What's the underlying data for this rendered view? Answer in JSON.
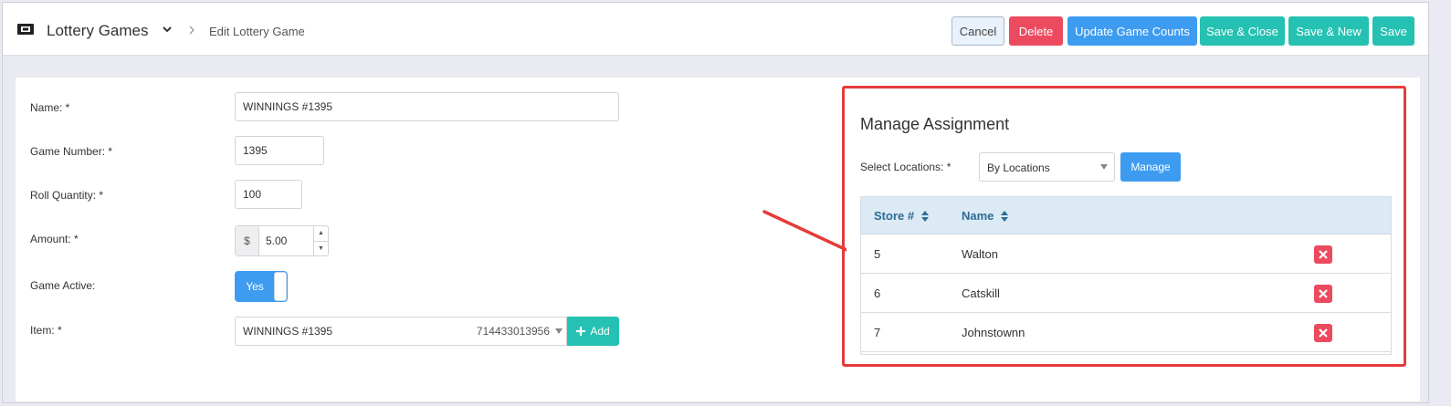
{
  "header": {
    "app_title": "Lottery Games",
    "breadcrumb": "Edit Lottery Game",
    "buttons": {
      "cancel": "Cancel",
      "delete": "Delete",
      "update_counts": "Update Game Counts",
      "save_close": "Save & Close",
      "save_new": "Save & New",
      "save": "Save"
    }
  },
  "form": {
    "name_label": "Name: *",
    "name_value": "WINNINGS #1395",
    "game_number_label": "Game Number: *",
    "game_number_value": "1395",
    "roll_quantity_label": "Roll Quantity: *",
    "roll_quantity_value": "100",
    "amount_label": "Amount: *",
    "amount_prefix": "$",
    "amount_value": "5.00",
    "game_active_label": "Game Active:",
    "game_active_value": "Yes",
    "item_label": "Item: *",
    "item_name": "WINNINGS #1395",
    "item_code": "714433013956",
    "add_label": "Add"
  },
  "assignment": {
    "title": "Manage Assignment",
    "select_locations_label": "Select Locations: *",
    "select_locations_value": "By Locations",
    "manage_label": "Manage",
    "columns": [
      "Store #",
      "Name"
    ],
    "rows": [
      {
        "store": "5",
        "name": "Walton"
      },
      {
        "store": "6",
        "name": "Catskill"
      },
      {
        "store": "7",
        "name": "Johnstownn"
      }
    ]
  },
  "colors": {
    "primary": "#3d9cf0",
    "success": "#25c1b2",
    "danger": "#ec4a5f",
    "highlight": "#e53b3b"
  }
}
